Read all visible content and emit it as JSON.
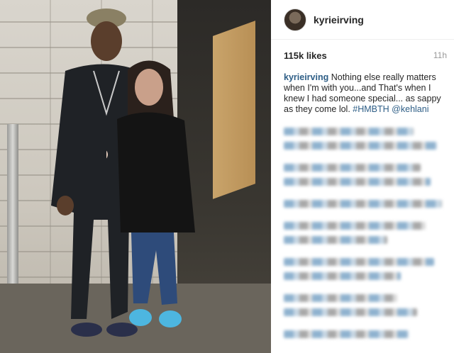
{
  "post": {
    "username": "kyrieirving",
    "likes": "115k likes",
    "time_ago": "11h"
  },
  "caption": {
    "user": "kyrieirving",
    "text": "Nothing else really matters when I'm with you...and That's when I knew I had someone special... as sappy as they come lol.",
    "hashtag": "#HMBTH",
    "mention": "@kehlani"
  },
  "icons": {
    "avatar": "profile-avatar"
  },
  "colors": {
    "link": "#2e5e86",
    "text": "#262626",
    "muted": "#999999"
  }
}
